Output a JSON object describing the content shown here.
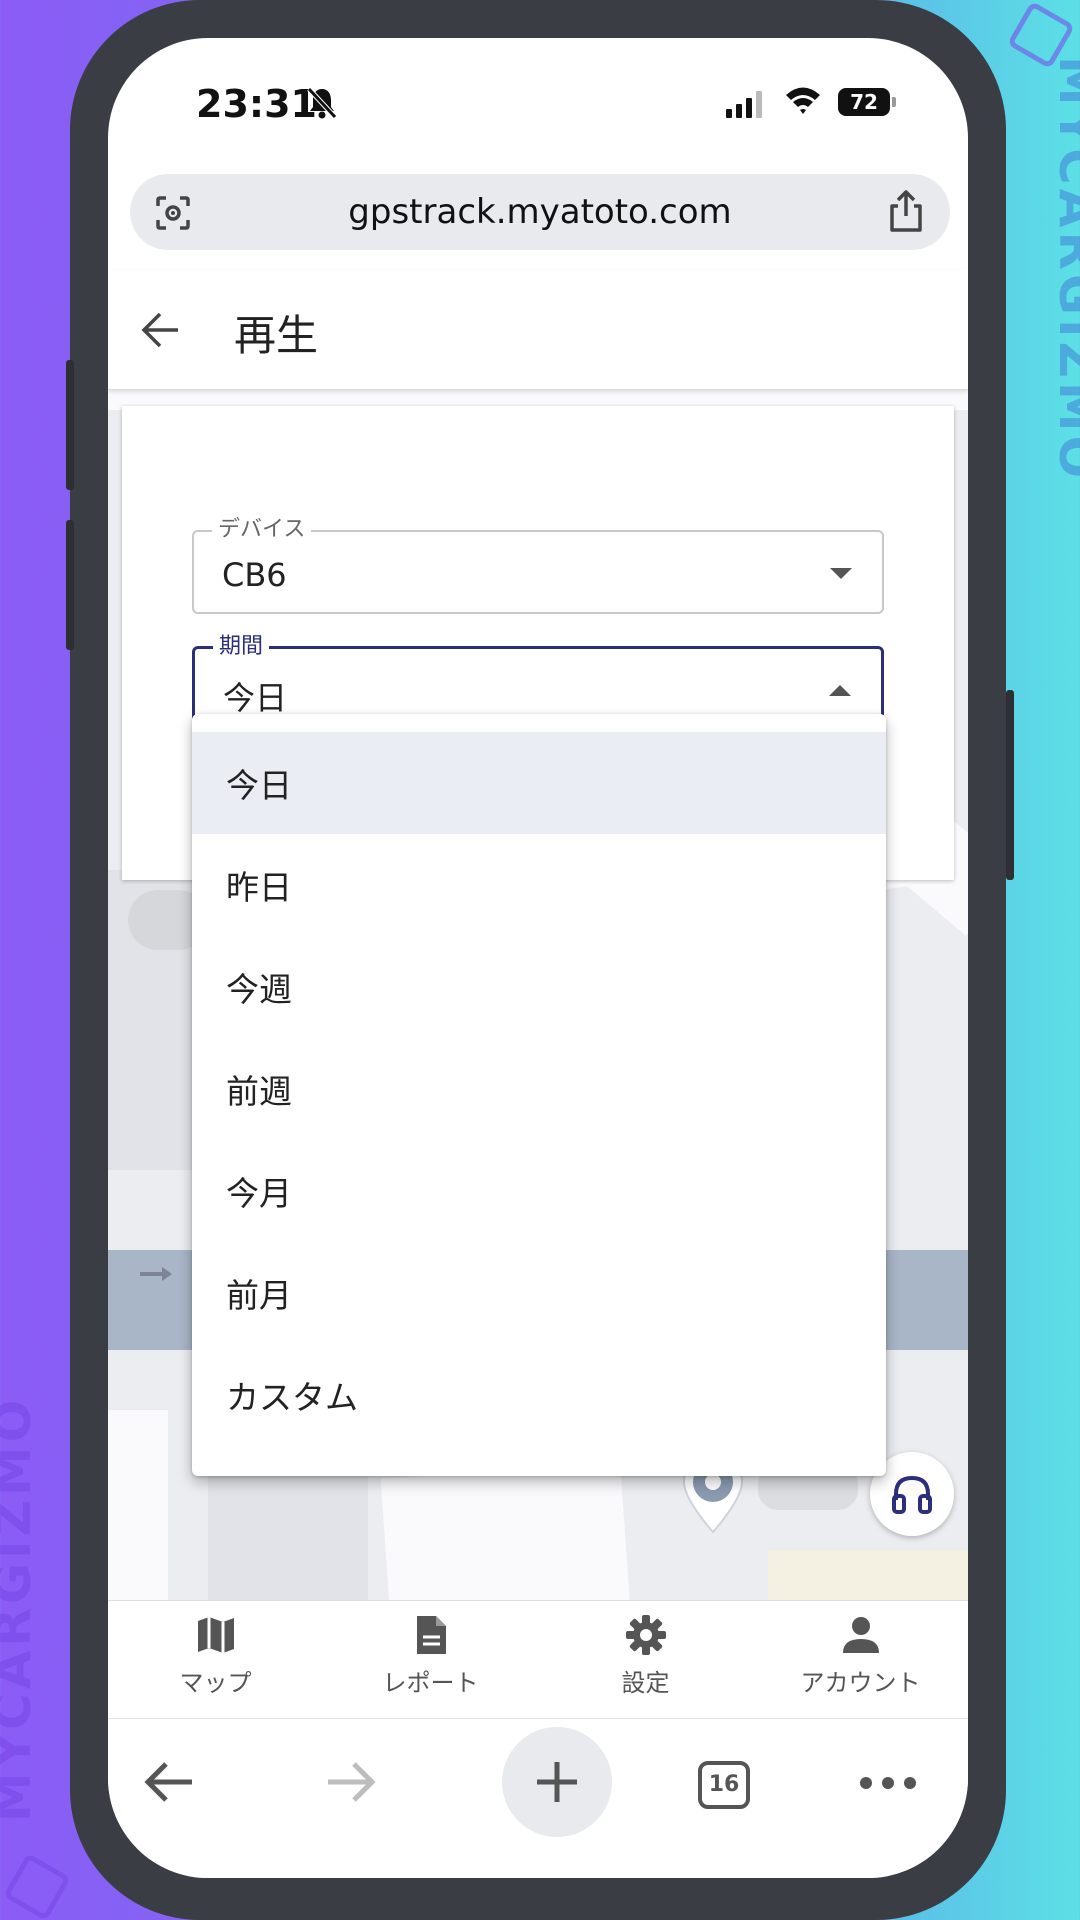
{
  "watermark": {
    "text": "MYCARGIZMO"
  },
  "status_bar": {
    "time": "23:31",
    "battery": "72"
  },
  "browser": {
    "url": "gpstrack.myatoto.com",
    "tab_count": "16"
  },
  "header": {
    "title": "再生"
  },
  "form": {
    "device": {
      "label": "デバイス",
      "value": "CB6"
    },
    "period": {
      "label": "期間",
      "value": "今日"
    }
  },
  "period_menu": {
    "options": [
      "今日",
      "昨日",
      "今週",
      "前週",
      "今月",
      "前月",
      "カスタム"
    ],
    "selected": "今日"
  },
  "bottom_nav": {
    "items": [
      {
        "label": "マップ",
        "icon": "map-icon"
      },
      {
        "label": "レポート",
        "icon": "report-icon"
      },
      {
        "label": "設定",
        "icon": "settings-icon"
      },
      {
        "label": "アカウント",
        "icon": "account-icon"
      }
    ]
  },
  "colors": {
    "accent": "#2b2f7a",
    "menu_selected_bg": "#ebedf4",
    "map_road_blue": "#a9b6c8"
  }
}
